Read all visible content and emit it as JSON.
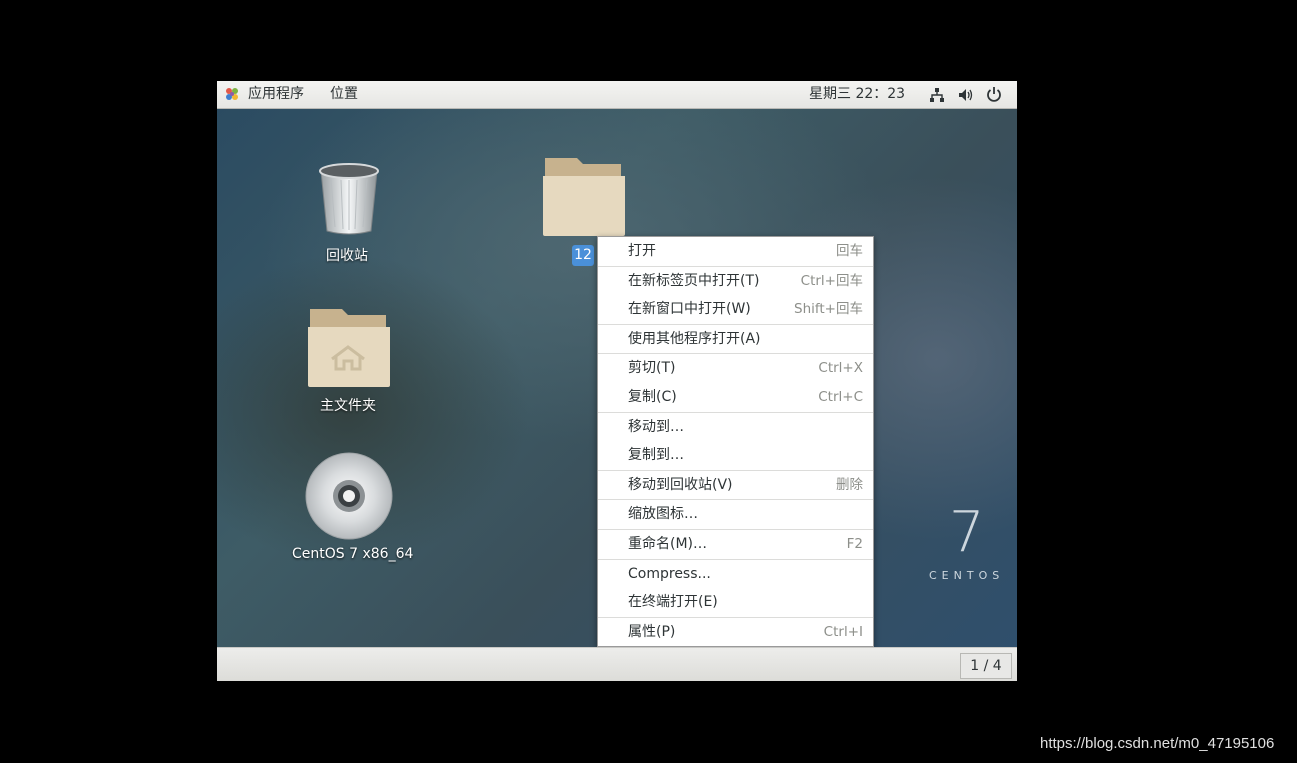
{
  "topbar": {
    "applications_label": "应用程序",
    "places_label": "位置",
    "clock": "星期三 22：23",
    "icons": [
      "applications-icon",
      "network-icon",
      "volume-icon",
      "power-icon"
    ]
  },
  "desktop": {
    "icons": [
      {
        "label": "回收站",
        "icon": "trash-icon"
      },
      {
        "label": "主文件夹",
        "icon": "home-folder-icon"
      },
      {
        "label": "CentOS 7 x86_64",
        "icon": "optical-disc-icon"
      },
      {
        "label": "12",
        "icon": "folder-icon",
        "selected": true
      }
    ],
    "logo": {
      "number": "7",
      "word": "CENTOS"
    }
  },
  "context_menu": {
    "items": [
      {
        "label": "打开",
        "accel": "回车"
      },
      {
        "label": "在新标签页中打开(T)",
        "accel": "Ctrl+回车"
      },
      {
        "label": "在新窗口中打开(W)",
        "accel": "Shift+回车"
      },
      {
        "label": "使用其他程序打开(A)",
        "accel": ""
      },
      {
        "label": "剪切(T)",
        "accel": "Ctrl+X"
      },
      {
        "label": "复制(C)",
        "accel": "Ctrl+C"
      },
      {
        "label": "移动到…",
        "accel": ""
      },
      {
        "label": "复制到…",
        "accel": ""
      },
      {
        "label": "移动到回收站(V)",
        "accel": "删除"
      },
      {
        "label": "缩放图标…",
        "accel": ""
      },
      {
        "label": "重命名(M)…",
        "accel": "F2"
      },
      {
        "label": "Compress...",
        "accel": ""
      },
      {
        "label": "在终端打开(E)",
        "accel": ""
      },
      {
        "label": "属性(P)",
        "accel": "Ctrl+I"
      }
    ]
  },
  "bottombar": {
    "workspace": "1 / 4"
  },
  "watermark": "https://blog.csdn.net/m0_47195106",
  "colors": {
    "selection": "#4a90d9",
    "folder": "#d8c8a8",
    "desktop": "#3a5566"
  }
}
